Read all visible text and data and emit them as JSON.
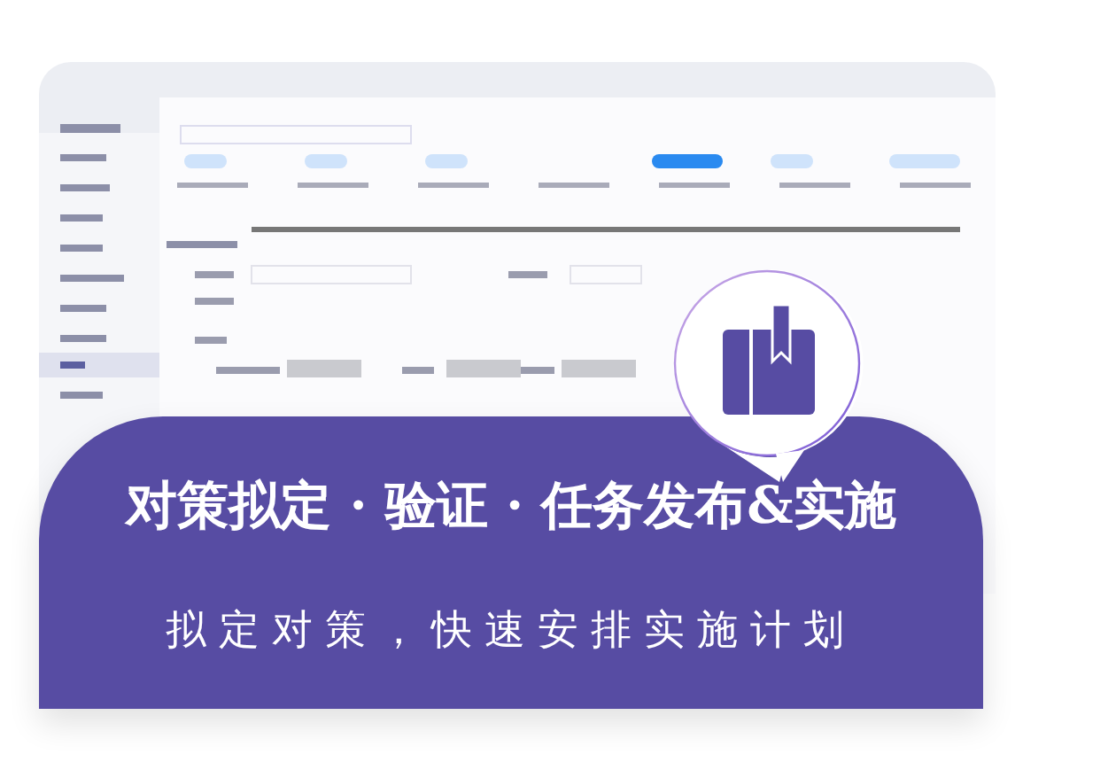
{
  "banner": {
    "title": "对策拟定 · 验证 · 任务发布&实施",
    "subtitle": "拟定对策，快速安排实施计划"
  }
}
